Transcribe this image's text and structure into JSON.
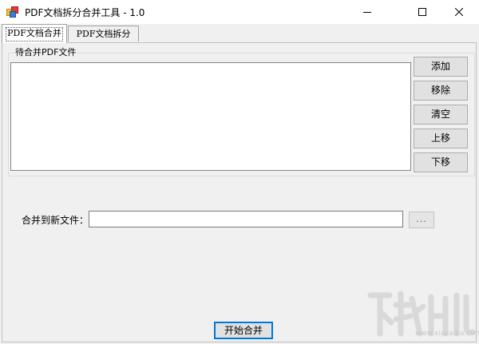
{
  "window": {
    "title": "PDF文档拆分合并工具 - 1.0",
    "controls": {
      "minimize_icon": "minimize-icon",
      "maximize_icon": "maximize-icon",
      "close_icon": "close-icon"
    }
  },
  "tabs": [
    {
      "label": "PDF文档合并",
      "active": true
    },
    {
      "label": "PDF文档拆分",
      "active": false
    }
  ],
  "merge": {
    "group_title": "待合并PDF文件",
    "files": [],
    "buttons": {
      "add": "添加",
      "remove": "移除",
      "clear": "清空",
      "move_up": "上移",
      "move_down": "下移"
    },
    "output": {
      "label": "合并到新文件：",
      "value": "",
      "browse": "..."
    },
    "start": "开始合并"
  },
  "watermark": {
    "url": "www.xiazaiba.com"
  },
  "colors": {
    "window_bg": "#f0f0f0",
    "titlebar_bg": "#ffffff",
    "button_bg": "#e1e1e1",
    "focus_border": "#0078d7"
  }
}
